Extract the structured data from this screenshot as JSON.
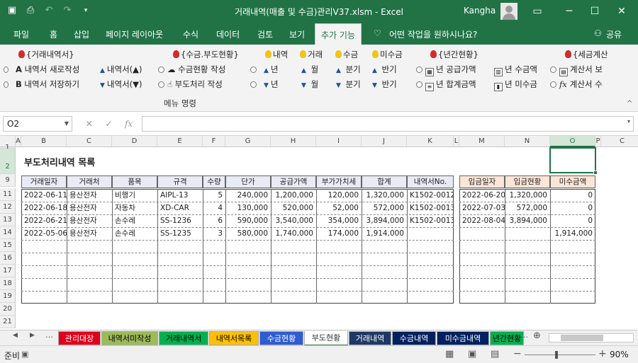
{
  "title": "거래내역(매출 및 수금)관리V37.xlsm  -  Excel",
  "user": "Kangha",
  "ribbon_tabs": [
    "파일",
    "홈",
    "삽입",
    "페이지 레이아웃",
    "수식",
    "데이터",
    "검토",
    "보기",
    "추가 기능"
  ],
  "tell_me": "어떤 작업을 원하시나요?",
  "share": "공유",
  "ribbon": {
    "g1_title": "{거래내역서}",
    "g1_new": "내역서 새로작성",
    "g1_save": "내역서 저장하기",
    "g1_up": "내역서(▲)",
    "g1_down": "내역서(▼)",
    "g1_a": "A",
    "g1_b": "B",
    "g2_title": "{수금.부도현황}",
    "g2_collect": "수금현황 작성",
    "g2_default": "부도처리 작성",
    "g3_items": [
      "내역",
      "거래",
      "수금",
      "미수금"
    ],
    "g3_year": "년",
    "g3_month": "월",
    "g3_quarter": "분기",
    "g3_half": "반기",
    "g4_title": "{년간현황}",
    "g4_supply": "년 공급가액",
    "g4_collect": "년 수금액",
    "g4_total": "년 합계금액",
    "g4_unpaid": "년 미수금",
    "g5_title": "{세금계산",
    "g5_view": "계산서 보",
    "g5_edit": "계산서 수",
    "group_name": "메뉴 명령"
  },
  "namebox": "O2",
  "sheet_title": "부도처리내역 목록",
  "columns": [
    "A",
    "B",
    "C",
    "D",
    "E",
    "F",
    "G",
    "H",
    "I",
    "J",
    "K",
    "L",
    "M",
    "N",
    "O",
    "P",
    "C"
  ],
  "rows": [
    "1",
    "2",
    "9",
    "11",
    "12",
    "13",
    "14",
    "15",
    "16",
    "17",
    "18",
    "19",
    "20",
    "21"
  ],
  "table_headers": [
    "거래일자",
    "거래처",
    "품목",
    "규격",
    "수량",
    "단가",
    "공급가액",
    "부가가치세",
    "합계",
    "내역서No."
  ],
  "table_rows": [
    [
      "2022-06-11",
      "용산전자",
      "비행기",
      "AIPL-13",
      "5",
      "240,000",
      "1,200,000",
      "120,000",
      "1,320,000",
      "K1502-0012"
    ],
    [
      "2022-06-18",
      "용산전자",
      "자동차",
      "XD-CAR",
      "4",
      "130,000",
      "520,000",
      "52,000",
      "572,000",
      "K1502-0013"
    ],
    [
      "2022-06-21",
      "용산전자",
      "손수레",
      "SS-1236",
      "6",
      "590,000",
      "3,540,000",
      "354,000",
      "3,894,000",
      "K1502-0013"
    ],
    [
      "2022-05-06",
      "용산전자",
      "손수레",
      "SS-1235",
      "3",
      "580,000",
      "1,740,000",
      "174,000",
      "1,914,000",
      ""
    ]
  ],
  "side_headers": [
    "입금일자",
    "입금현황",
    "미수금액"
  ],
  "side_rows": [
    [
      "2022-06-20",
      "1,320,000",
      "0"
    ],
    [
      "2022-07-03",
      "572,000",
      "0"
    ],
    [
      "2022-08-04",
      "3,894,000",
      "0"
    ],
    [
      "",
      "",
      "1,914,000"
    ]
  ],
  "sheet_tabs": [
    {
      "label": "관리대장",
      "bg": "#e0001b",
      "fg": "#ffffff"
    },
    {
      "label": "내역서미작성",
      "bg": "#9bbb59",
      "fg": "#000000"
    },
    {
      "label": "거래내역서",
      "bg": "#00b050",
      "fg": "#000000"
    },
    {
      "label": "내역서목록",
      "bg": "#ffc000",
      "fg": "#000000"
    },
    {
      "label": "수금현황",
      "bg": "#2f5cd3",
      "fg": "#ffffff"
    },
    {
      "label": "부도현황",
      "bg": "#ffffff",
      "fg": "#333333"
    },
    {
      "label": "거래내역",
      "bg": "#1f3864",
      "fg": "#ffffff"
    },
    {
      "label": "수금내역",
      "bg": "#002060",
      "fg": "#ffffff"
    },
    {
      "label": "미수금내역",
      "bg": "#002060",
      "fg": "#ffffff"
    },
    {
      "label": "년간현황",
      "bg": "#00b050",
      "fg": "#000000"
    }
  ],
  "status": {
    "ready": "준비",
    "zoom": "90%"
  }
}
